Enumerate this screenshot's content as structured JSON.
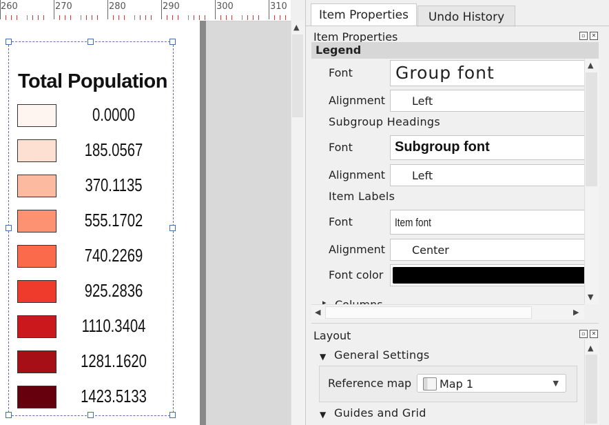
{
  "ruler": {
    "labels": [
      "260",
      "270",
      "280",
      "290",
      "300",
      "310"
    ]
  },
  "legend": {
    "title": "Total Population",
    "items": [
      {
        "label": "0.0000",
        "color": "#fff5f0"
      },
      {
        "label": "185.0567",
        "color": "#fee0d2"
      },
      {
        "label": "370.1135",
        "color": "#fcbba1"
      },
      {
        "label": "555.1702",
        "color": "#fc9272"
      },
      {
        "label": "740.2269",
        "color": "#fb6a4a"
      },
      {
        "label": "925.2836",
        "color": "#ef3b2c"
      },
      {
        "label": "1110.3404",
        "color": "#cb181d"
      },
      {
        "label": "1281.1620",
        "color": "#a50f15"
      },
      {
        "label": "1423.5133",
        "color": "#67000d"
      }
    ]
  },
  "tabs": {
    "item_properties": "Item Properties",
    "undo_history": "Undo History"
  },
  "item_properties": {
    "panel_title": "Item Properties",
    "section": "Legend",
    "group_font_label": "Font",
    "group_font_value": "Group font",
    "group_alignment_label": "Alignment",
    "group_alignment_value": "Left",
    "subgroup_heading": "Subgroup Headings",
    "subgroup_font_label": "Font",
    "subgroup_font_value": "Subgroup font",
    "subgroup_alignment_label": "Alignment",
    "subgroup_alignment_value": "Left",
    "item_labels_heading": "Item Labels",
    "item_font_label": "Font",
    "item_font_value": "Item font",
    "item_alignment_label": "Alignment",
    "item_alignment_value": "Center",
    "font_color_label": "Font color",
    "font_color_value": "#000000",
    "columns_heading": "Columns"
  },
  "layout_panel": {
    "title": "Layout",
    "general_settings": "General Settings",
    "reference_map_label": "Reference map",
    "reference_map_value": "Map 1",
    "guides_and_grid": "Guides and Grid"
  }
}
